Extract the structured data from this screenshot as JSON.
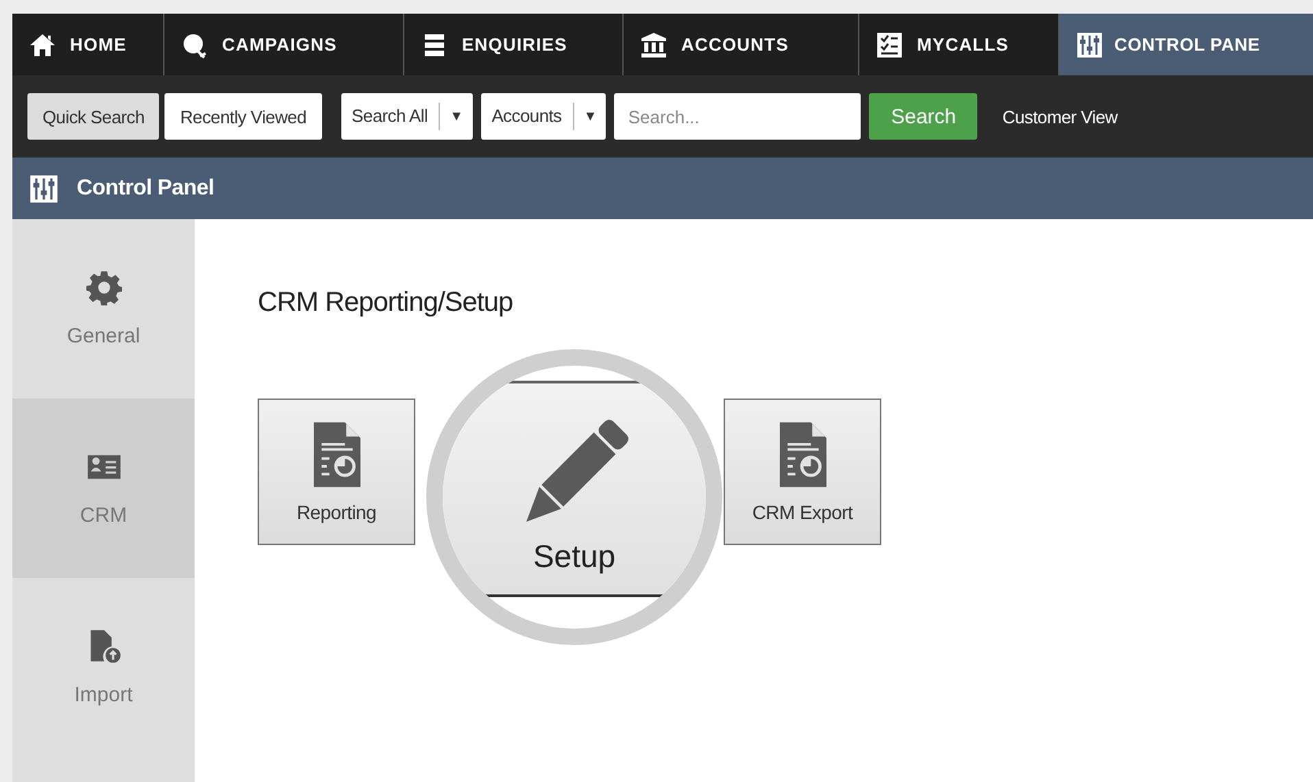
{
  "nav": [
    {
      "label": "HOME",
      "selected": false
    },
    {
      "label": "CAMPAIGNS",
      "selected": false
    },
    {
      "label": "ENQUIRIES",
      "selected": false
    },
    {
      "label": "ACCOUNTS",
      "selected": false
    },
    {
      "label": "MYCALLS",
      "selected": false
    },
    {
      "label": "CONTROL PANE",
      "selected": true
    }
  ],
  "toolbar": {
    "tabs": [
      {
        "label": "Quick Search",
        "selected": true
      },
      {
        "label": "Recently Viewed",
        "selected": false
      }
    ],
    "dropdowns": [
      {
        "value": "Search All",
        "arrow": "▼"
      },
      {
        "value": "Accounts",
        "arrow": "▼"
      }
    ],
    "search": {
      "placeholder": "Search..."
    },
    "search_button": "Search",
    "link": "Customer View"
  },
  "header": {
    "title": "Control Panel"
  },
  "sidebar": {
    "items": [
      {
        "label": "General",
        "selected": false
      },
      {
        "label": "CRM",
        "selected": true
      },
      {
        "label": "Import",
        "selected": false
      }
    ]
  },
  "main": {
    "title": "CRM Reporting/Setup",
    "tiles": [
      {
        "label": "Reporting"
      },
      {
        "label": "CRM Export"
      }
    ],
    "magnified": {
      "label": "Setup"
    }
  }
}
